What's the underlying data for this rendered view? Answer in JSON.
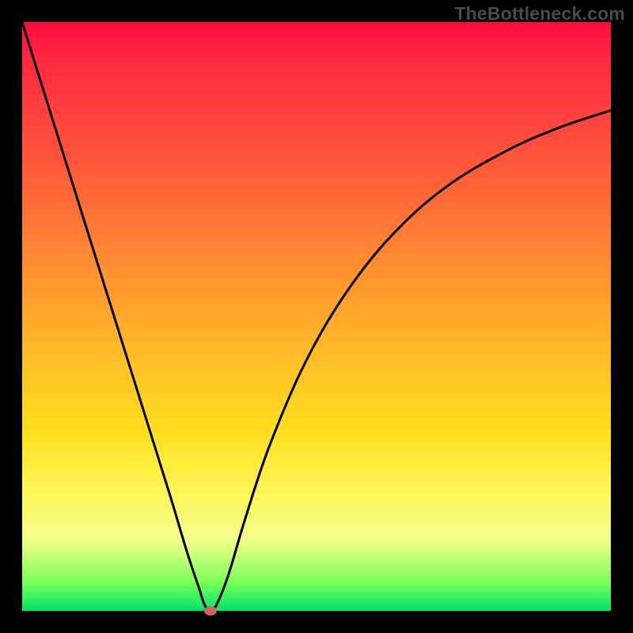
{
  "watermark": "TheBottleneck.com",
  "chart_data": {
    "type": "line",
    "title": "",
    "xlabel": "",
    "ylabel": "",
    "xlim": [
      0,
      100
    ],
    "ylim": [
      0,
      100
    ],
    "series": [
      {
        "name": "curve",
        "x": [
          0,
          5,
          10,
          15,
          20,
          25,
          28,
          30,
          31,
          32,
          33,
          35,
          38,
          42,
          48,
          55,
          63,
          72,
          82,
          91,
          100
        ],
        "y": [
          100,
          84,
          68,
          52,
          36,
          20,
          10,
          4,
          1,
          0,
          1,
          6,
          16,
          28,
          42,
          54,
          64,
          72,
          78,
          82,
          85
        ]
      }
    ],
    "marker": {
      "x": 32,
      "y": 0
    },
    "gradient_stops": [
      {
        "pos": 0,
        "color": "#ff0b3f"
      },
      {
        "pos": 25,
        "color": "#ff5a3a"
      },
      {
        "pos": 55,
        "color": "#ffb829"
      },
      {
        "pos": 80,
        "color": "#fff65a"
      },
      {
        "pos": 100,
        "color": "#00e56a"
      }
    ]
  }
}
